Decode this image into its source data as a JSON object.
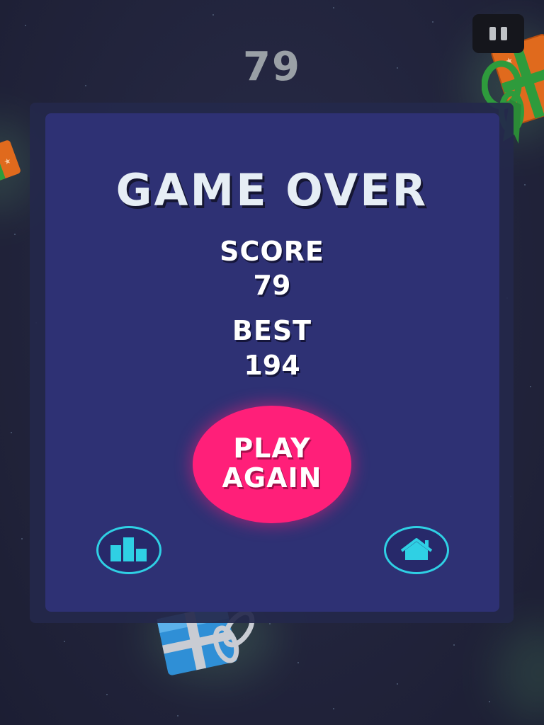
{
  "hud": {
    "score": "79",
    "pause_icon": "pause-icon"
  },
  "dialog": {
    "title": "GAME OVER",
    "score_label": "SCORE",
    "score_value": "79",
    "best_label": "BEST",
    "best_value": "194",
    "play_again_line1": "PLAY",
    "play_again_line2": "AGAIN",
    "leaderboard_icon": "leaderboard-icon",
    "home_icon": "home-icon"
  },
  "colors": {
    "background": "#22253f",
    "panel": "#2e3174",
    "accent_pink": "#ff1f79",
    "accent_cyan": "#2fd0e4",
    "title_text": "#e6eef5",
    "hud_score": "#9aa0a6"
  },
  "decorations": {
    "gifts": [
      "orange-gift-green-ribbon-top-right",
      "orange-gift-left-edge",
      "blue-gift-silver-ribbon-bottom"
    ]
  }
}
